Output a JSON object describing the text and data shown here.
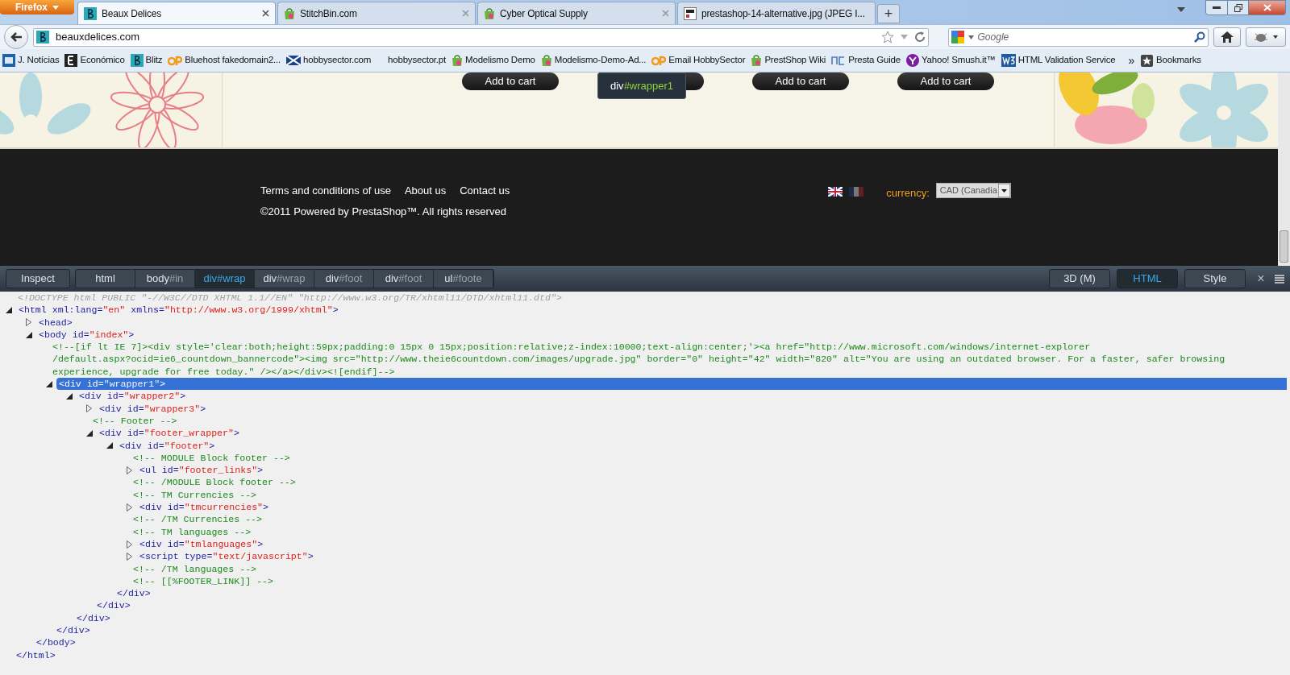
{
  "browser": {
    "menu_button": "Firefox",
    "tabs": [
      {
        "title": "Beaux Delices",
        "kind": "b",
        "selected": true
      },
      {
        "title": "StitchBin.com",
        "kind": "bag",
        "selected": false
      },
      {
        "title": "Cyber Optical Supply",
        "kind": "bag",
        "selected": false
      },
      {
        "title": "prestashop-14-alternative.jpg (JPEG I...",
        "kind": "image",
        "selected": false
      }
    ],
    "new_tab": "+",
    "address": "beauxdelices.com",
    "search_placeholder": "Google",
    "bookmarks": [
      {
        "kind": "jn",
        "label": "J. Notícias"
      },
      {
        "kind": "e",
        "label": "Económico"
      },
      {
        "kind": "b",
        "label": "Blitz"
      },
      {
        "kind": "cp",
        "label": "Bluehost fakedomain2..."
      },
      {
        "kind": "flag",
        "label": "hobbysector.com"
      },
      {
        "kind": "none",
        "label": "hobbysector.pt"
      },
      {
        "kind": "bag",
        "label": "Modelismo Demo"
      },
      {
        "kind": "bag",
        "label": "Modelismo-Demo-Ad..."
      },
      {
        "kind": "cp",
        "label": "Email HobbySector"
      },
      {
        "kind": "bag",
        "label": "PrestShop Wiki"
      },
      {
        "kind": "nc",
        "label": "Presta Guide"
      },
      {
        "kind": "yahoo",
        "label": "Yahoo! Smush.it™"
      },
      {
        "kind": "w3",
        "label": "HTML Validation Service"
      }
    ],
    "bookmarks_overflow": "»",
    "bookmarks_menu": "Bookmarks"
  },
  "page": {
    "cart_buttons": [
      "Add to cart",
      "Add to cart",
      "Add to cart"
    ],
    "highlight_tooltip": {
      "tag": "div",
      "id": "#wrapper1"
    },
    "footer_links": [
      "Terms and conditions of use",
      "About us",
      "Contact us"
    ],
    "copyright": "©2011 Powered by PrestaShop™. All rights reserved",
    "currency_label": "currency:",
    "currency_value": "CAD (Canadia"
  },
  "inspector": {
    "inspect_button": "Inspect",
    "breadcrumbs": [
      {
        "tag": "html",
        "selected": false
      },
      {
        "tag": "body",
        "id": "#in",
        "selected": false
      },
      {
        "tag": "div",
        "id": "#wrap",
        "selected": true
      },
      {
        "tag": "div",
        "id": "#wrap",
        "selected": false
      },
      {
        "tag": "div",
        "id": "#foot",
        "selected": false
      },
      {
        "tag": "div",
        "id": "#foot",
        "selected": false
      },
      {
        "tag": "ul",
        "id": "#foote",
        "selected": false
      }
    ],
    "views": [
      {
        "label": "3D (M)",
        "selected": false
      },
      {
        "label": "HTML",
        "selected": true
      },
      {
        "label": "Style",
        "selected": false
      }
    ],
    "close": "×",
    "tree": [
      {
        "kind": "doctype",
        "text": "<!DOCTYPE html PUBLIC \"-//W3C//DTD XHTML 1.1//EN\" \"http://www.w3.org/TR/xhtml11/DTD/xhtml11.dtd\">"
      },
      {
        "kind": "element",
        "expanded": true,
        "selected": false,
        "tokens": [
          {
            "kind": "tag",
            "text": "<html xml:lang="
          },
          {
            "kind": "value",
            "text": "\"en\""
          },
          {
            "kind": "tag",
            "text": " xmlns="
          },
          {
            "kind": "value",
            "text": "\"http://www.w3.org/1999/xhtml\""
          },
          {
            "kind": "tag",
            "text": ">"
          }
        ],
        "closing": "</html>",
        "children": [
          {
            "kind": "element",
            "expanded": false,
            "selected": false,
            "tokens": [
              {
                "kind": "tag",
                "text": "<head>"
              }
            ]
          },
          {
            "kind": "element",
            "expanded": true,
            "selected": false,
            "tokens": [
              {
                "kind": "tag",
                "text": "<body id="
              },
              {
                "kind": "value",
                "text": "\"index\""
              },
              {
                "kind": "tag",
                "text": ">"
              }
            ],
            "closing": "</body>",
            "children": [
              {
                "kind": "comment",
                "lines": [
                  "<!--[if lt IE 7]><div style='clear:both;height:59px;padding:0 15px 0 15px;position:relative;z-index:10000;text-align:center;'><a href=\"http://www.microsoft.com/windows/internet-explorer",
                  "/default.aspx?ocid=ie6_countdown_bannercode\"><img src=\"http://www.theie6countdown.com/images/upgrade.jpg\" border=\"0\" height=\"42\" width=\"820\" alt=\"You are using an outdated browser. For a faster, safer browsing",
                  "experience, upgrade for free today.\" /></a></div><![endif]-->"
                ]
              },
              {
                "kind": "element",
                "expanded": true,
                "selected": true,
                "tokens": [
                  {
                    "kind": "tag",
                    "text": "<div id="
                  },
                  {
                    "kind": "value",
                    "text": "\"wrapper1\""
                  },
                  {
                    "kind": "tag",
                    "text": ">"
                  }
                ],
                "closing": "</div>",
                "children": [
                  {
                    "kind": "element",
                    "expanded": true,
                    "selected": false,
                    "tokens": [
                      {
                        "kind": "tag",
                        "text": "<div id="
                      },
                      {
                        "kind": "value",
                        "text": "\"wrapper2\""
                      },
                      {
                        "kind": "tag",
                        "text": ">"
                      }
                    ],
                    "closing": "</div>",
                    "children": [
                      {
                        "kind": "element",
                        "expanded": false,
                        "selected": false,
                        "tokens": [
                          {
                            "kind": "tag",
                            "text": "<div id="
                          },
                          {
                            "kind": "value",
                            "text": "\"wrapper3\""
                          },
                          {
                            "kind": "tag",
                            "text": ">"
                          }
                        ]
                      },
                      {
                        "kind": "comment",
                        "lines": [
                          "<!-- Footer -->"
                        ]
                      },
                      {
                        "kind": "element",
                        "expanded": true,
                        "selected": false,
                        "tokens": [
                          {
                            "kind": "tag",
                            "text": "<div id="
                          },
                          {
                            "kind": "value",
                            "text": "\"footer_wrapper\""
                          },
                          {
                            "kind": "tag",
                            "text": ">"
                          }
                        ],
                        "closing": "</div>",
                        "children": [
                          {
                            "kind": "element",
                            "expanded": true,
                            "selected": false,
                            "tokens": [
                              {
                                "kind": "tag",
                                "text": "<div id="
                              },
                              {
                                "kind": "value",
                                "text": "\"footer\""
                              },
                              {
                                "kind": "tag",
                                "text": ">"
                              }
                            ],
                            "closing": "</div>",
                            "children": [
                              {
                                "kind": "comment",
                                "lines": [
                                  "<!-- MODULE Block footer -->"
                                ]
                              },
                              {
                                "kind": "element",
                                "expanded": false,
                                "selected": false,
                                "tokens": [
                                  {
                                    "kind": "tag",
                                    "text": "<ul id="
                                  },
                                  {
                                    "kind": "value",
                                    "text": "\"footer_links\""
                                  },
                                  {
                                    "kind": "tag",
                                    "text": ">"
                                  }
                                ]
                              },
                              {
                                "kind": "comment",
                                "lines": [
                                  "<!-- /MODULE Block footer -->"
                                ]
                              },
                              {
                                "kind": "comment",
                                "lines": [
                                  "<!-- TM Currencies -->"
                                ]
                              },
                              {
                                "kind": "element",
                                "expanded": false,
                                "selected": false,
                                "tokens": [
                                  {
                                    "kind": "tag",
                                    "text": "<div id="
                                  },
                                  {
                                    "kind": "value",
                                    "text": "\"tmcurrencies\""
                                  },
                                  {
                                    "kind": "tag",
                                    "text": ">"
                                  }
                                ]
                              },
                              {
                                "kind": "comment",
                                "lines": [
                                  "<!-- /TM Currencies -->"
                                ]
                              },
                              {
                                "kind": "comment",
                                "lines": [
                                  "<!-- TM languages -->"
                                ]
                              },
                              {
                                "kind": "element",
                                "expanded": false,
                                "selected": false,
                                "tokens": [
                                  {
                                    "kind": "tag",
                                    "text": "<div id="
                                  },
                                  {
                                    "kind": "value",
                                    "text": "\"tmlanguages\""
                                  },
                                  {
                                    "kind": "tag",
                                    "text": ">"
                                  }
                                ]
                              },
                              {
                                "kind": "element",
                                "expanded": false,
                                "selected": false,
                                "tokens": [
                                  {
                                    "kind": "tag",
                                    "text": "<script type="
                                  },
                                  {
                                    "kind": "value",
                                    "text": "\"text/javascript\""
                                  },
                                  {
                                    "kind": "tag",
                                    "text": ">"
                                  }
                                ]
                              },
                              {
                                "kind": "comment",
                                "lines": [
                                  "<!-- /TM languages -->"
                                ]
                              },
                              {
                                "kind": "comment",
                                "lines": [
                                  "<!-- [[%FOOTER_LINK]] -->"
                                ]
                              }
                            ]
                          }
                        ]
                      }
                    ]
                  }
                ]
              }
            ]
          }
        ]
      }
    ]
  }
}
